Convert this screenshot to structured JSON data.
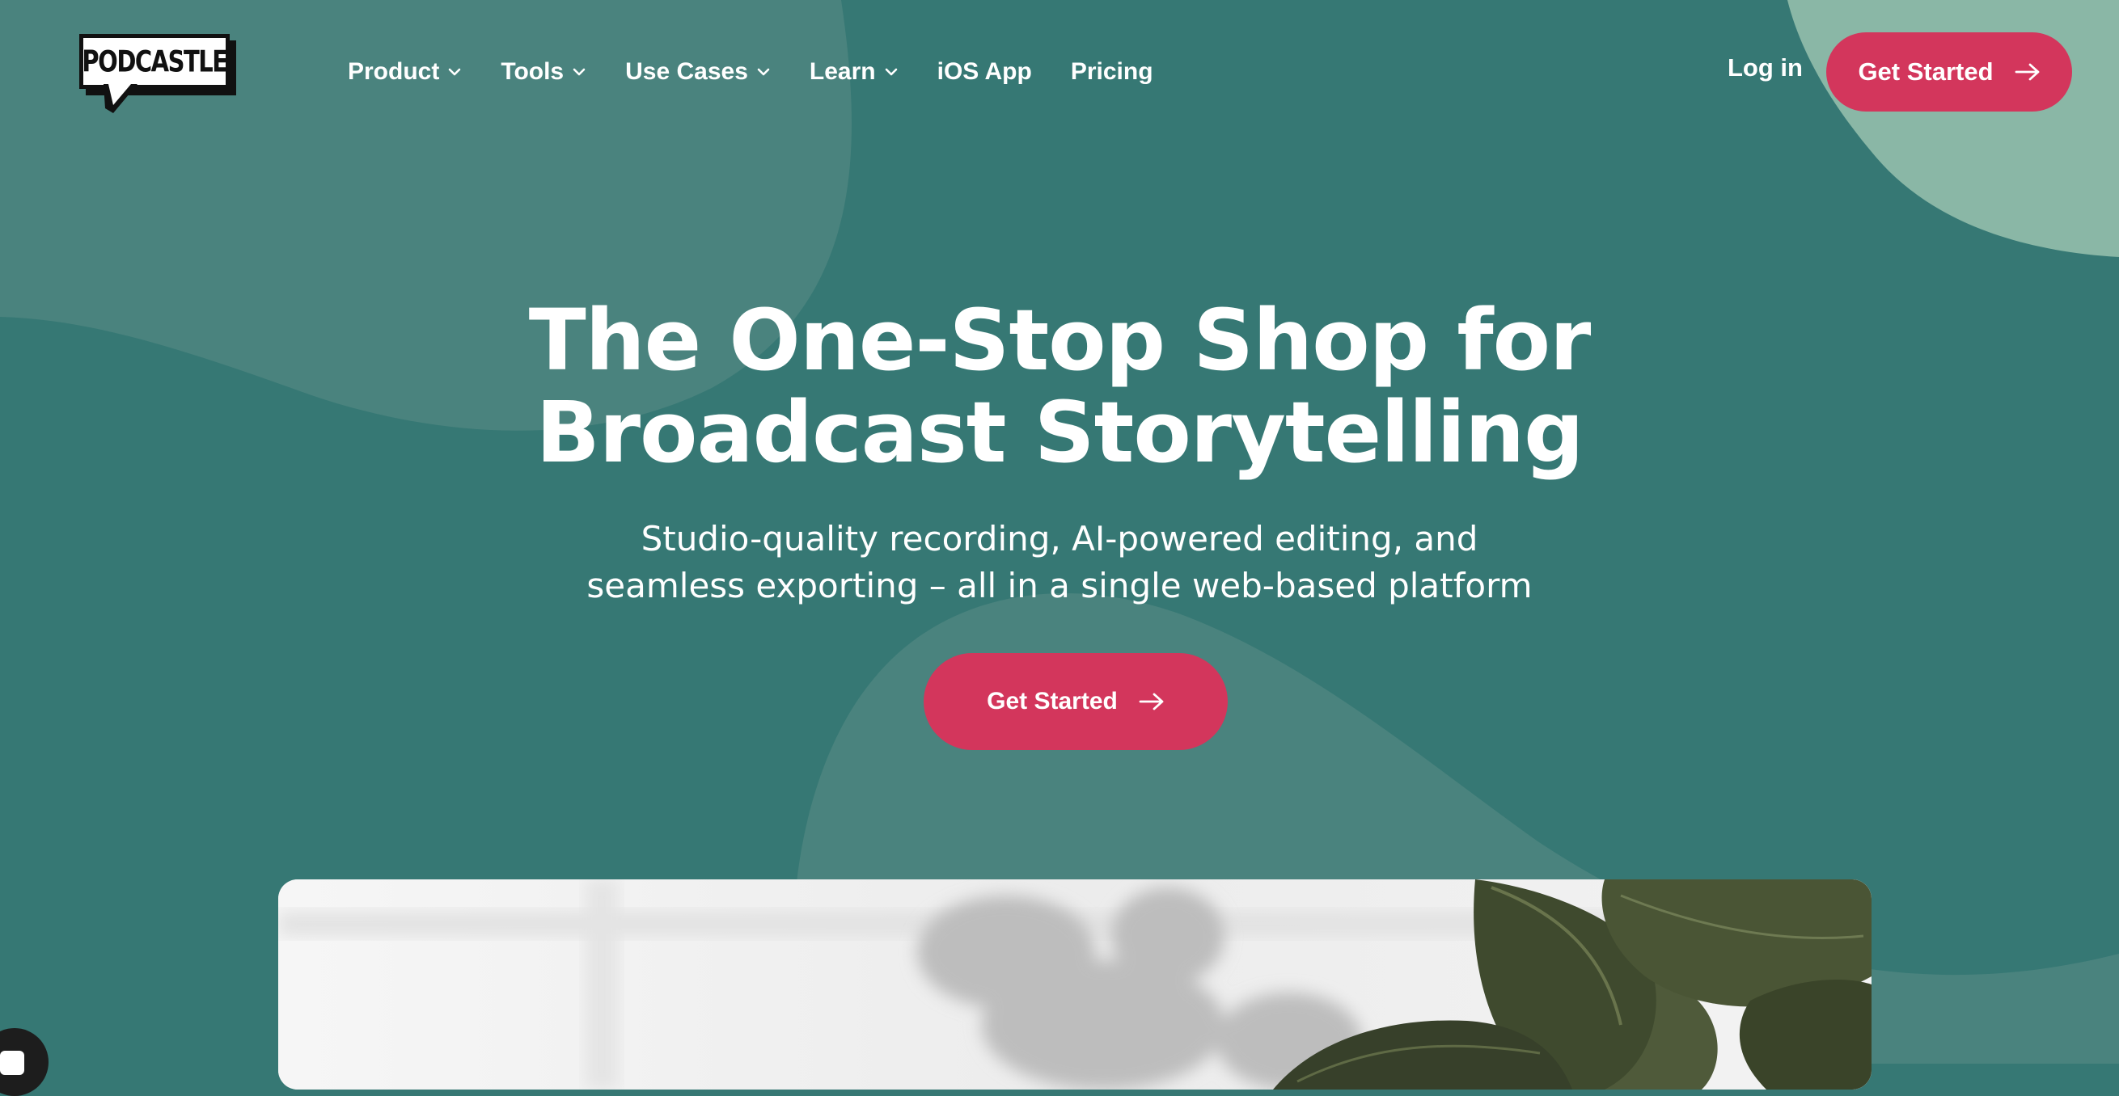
{
  "brand": {
    "logo_text": "PODCASTLE"
  },
  "nav": {
    "items": [
      {
        "label": "Product",
        "has_dropdown": true
      },
      {
        "label": "Tools",
        "has_dropdown": true
      },
      {
        "label": "Use Cases",
        "has_dropdown": true
      },
      {
        "label": "Learn",
        "has_dropdown": true
      },
      {
        "label": "iOS App",
        "has_dropdown": false
      },
      {
        "label": "Pricing",
        "has_dropdown": false
      }
    ],
    "login_label": "Log in",
    "cta_label": "Get Started"
  },
  "hero": {
    "title_line1": "The One-Stop Shop for",
    "title_line2": "Broadcast Storytelling",
    "subtitle_line1": "Studio-quality recording, AI-powered editing, and",
    "subtitle_line2": "seamless exporting – all in a single web-based platform",
    "cta_label": "Get Started"
  },
  "colors": {
    "background": "#367874",
    "shape_light": "#4a837e",
    "shape_mint": "#8ab7a6",
    "accent": "#d3365c",
    "text": "#ffffff"
  },
  "icons": [
    "chevron-down-icon",
    "arrow-right-icon",
    "speech-bubble-icon",
    "chat-icon"
  ]
}
